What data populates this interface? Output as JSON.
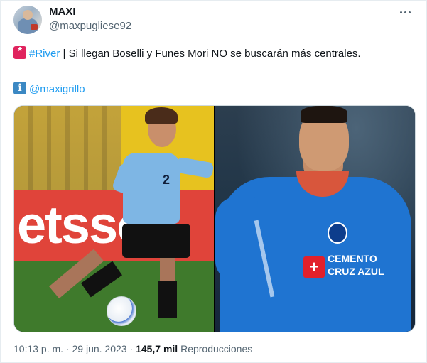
{
  "author": {
    "display_name": "MAXI",
    "handle": "@maxpugliese92"
  },
  "icons": {
    "avatar": "profile-avatar",
    "more": "more-horizontal-icon",
    "siren": "police-light-emoji",
    "info": "information-emoji"
  },
  "tweet": {
    "line1": {
      "hashtag": "#River",
      "rest": " | Si llegan Boselli y Funes Mori NO se buscarán más centrales."
    },
    "line2": {
      "mention": "@maxigrillo"
    }
  },
  "media": {
    "left": {
      "ad_text": "etsso",
      "jersey_number": "2"
    },
    "right": {
      "sponsor_line1": "CEMENTO",
      "sponsor_line2": "CRUZ AZUL"
    }
  },
  "footer": {
    "time": "10:13 p. m.",
    "sep1": " · ",
    "date": "29 jun. 2023",
    "sep2": " · ",
    "views_count": "145,7 mil",
    "views_label": " Reproducciones"
  },
  "colors": {
    "link": "#1d9bf0",
    "text": "#0f1419",
    "muted": "#536471"
  }
}
